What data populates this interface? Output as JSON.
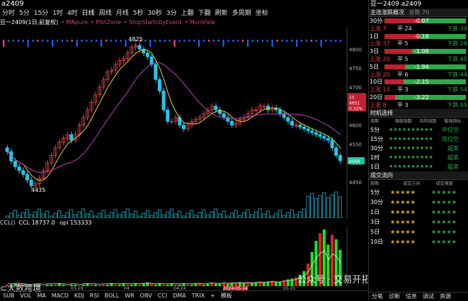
{
  "window": {
    "symbol": "a2409"
  },
  "toolbar": {
    "items": [
      "分时",
      "5分",
      "15分",
      "1时",
      "4时",
      "日线",
      "周线",
      "月线",
      "5秒",
      "30秒",
      "3分",
      "上翻",
      "下翻",
      "刷新",
      "多周期",
      "坐标"
    ]
  },
  "indicator_row": [
    "豆一2409(1日,前复权)",
    "MApure",
    "PlotZone",
    "StopStartsbyEvent",
    "MonView"
  ],
  "price_axis": [
    "4800",
    "4750",
    "4700",
    "4650",
    "4600",
    "4550",
    "4500",
    "4450"
  ],
  "price_box": {
    "line1": "15",
    "line2": "4651",
    "line3": "0.32%"
  },
  "last_price_tag": "4506",
  "high_label": "4825",
  "low_label": "4435",
  "volume_label": {
    "name": "CCL()",
    "ccl": "CCL 18737.0",
    "opi": "opi 153333"
  },
  "date_axis": [
    "03-19",
    "04",
    "04-24",
    "2024-05-14",
    "05-31"
  ],
  "bottom_tabs": [
    "SUB",
    "VOL",
    "MA",
    "MACD",
    "KDJ",
    "RSI",
    "BOLL",
    "WR",
    "OBV",
    "CCI",
    "DMA",
    "TRIX",
    "+",
    "模板"
  ],
  "right_panel": {
    "title": "豆一2409 a2409",
    "summary_section": "主连涨跌概况",
    "summary_sub": "总数 70",
    "rows": [
      {
        "period": "30分",
        "value": "-0.07",
        "up": "",
        "flat": "",
        "down": ""
      },
      {
        "period": "",
        "value": "",
        "up": "上涨 7",
        "flat": "平 24",
        "down": "下跌 39"
      },
      {
        "period": "1日",
        "value": "-0.18",
        "up": "",
        "flat": "",
        "down": ""
      },
      {
        "period": "",
        "value": "",
        "up": "上涨 37",
        "flat": "平 5",
        "down": "下跌 28"
      },
      {
        "period": "3日",
        "value": "-1.08",
        "up": "",
        "flat": "",
        "down": ""
      },
      {
        "period": "",
        "value": "",
        "up": "上涨 20",
        "flat": "平 5",
        "down": "下跌 45"
      },
      {
        "period": "5日",
        "value": "-1.94",
        "up": "",
        "flat": "",
        "down": ""
      },
      {
        "period": "",
        "value": "",
        "up": "上涨 20",
        "flat": "平 6",
        "down": "下跌 44"
      },
      {
        "period": "10日",
        "value": "-2.15",
        "up": "",
        "flat": "",
        "down": ""
      },
      {
        "period": "",
        "value": "",
        "up": "上涨 13",
        "flat": "平 3",
        "down": "下跌 54"
      },
      {
        "period": "20日",
        "value": "-3.22",
        "up": "",
        "flat": "",
        "down": ""
      },
      {
        "period": "",
        "value": "",
        "up": "上涨 8",
        "flat": "平 3",
        "down": "下跌 59"
      }
    ],
    "signal_section": "时机选择",
    "signal_headers": [
      "周期",
      "强度指数",
      "风险指数",
      "做强指标"
    ],
    "signals": [
      {
        "period": "5分",
        "stars": "★★★★★★★★★★",
        "text": "中位空"
      },
      {
        "period": "15分",
        "stars": "★★★★★★★★★★",
        "text": "低位空"
      },
      {
        "period": "30分",
        "stars": "★★★★★★★★★★",
        "text": "超卖"
      },
      {
        "period": "1时",
        "stars": "★★★★★★★★★★",
        "text": "超卖"
      },
      {
        "period": "1日",
        "stars": "★★★★★★★★★★",
        "text": "超卖"
      }
    ],
    "direction_section": "成交流向",
    "direction_headers": [
      "周期",
      "成交方向",
      "成交强度"
    ],
    "directions": [
      {
        "period": "5分",
        "s1": "★★★★★",
        "s2": "★★★★★"
      },
      {
        "period": "30分",
        "s1": "★★★★★",
        "s2": "★★★★★"
      },
      {
        "period": "1日",
        "s1": "★★★★★",
        "s2": "★★★★★"
      },
      {
        "period": "3日",
        "s1": "★★★★★",
        "s2": "★★★★★"
      },
      {
        "period": "5日",
        "s1": "★★★★★",
        "s2": "★★★★★"
      },
      {
        "period": "10日",
        "s1": "★★★★★",
        "s2": "★★★★★"
      }
    ],
    "bottom_tabs": [
      "分笔",
      "诊断",
      "信息",
      "调试",
      "资源"
    ]
  },
  "watermark": "公众号 · 交易开拓者TB",
  "logo_text": "大数跨境",
  "colors": {
    "up": "#e04040",
    "down": "#22c8e8",
    "ma_yellow": "#e8d040",
    "ma_purple": "#c040c0",
    "vol_green": "#22e022"
  },
  "chart_data": {
    "type": "candlestick",
    "price_ylim": [
      4420,
      4840
    ],
    "closes_approx": [
      4530,
      4505,
      4490,
      4480,
      4470,
      4455,
      4440,
      4445,
      4460,
      4480,
      4500,
      4520,
      4540,
      4555,
      4565,
      4575,
      4560,
      4575,
      4600,
      4620,
      4640,
      4660,
      4680,
      4700,
      4720,
      4740,
      4745,
      4760,
      4770,
      4775,
      4790,
      4805,
      4810,
      4800,
      4790,
      4780,
      4760,
      4720,
      4690,
      4640,
      4610,
      4610,
      4620,
      4600,
      4590,
      4600,
      4610,
      4615,
      4620,
      4630,
      4640,
      4650,
      4640,
      4630,
      4620,
      4610,
      4600,
      4605,
      4615,
      4620,
      4630,
      4640,
      4640,
      4650,
      4650,
      4640,
      4645,
      4640,
      4630,
      4620,
      4610,
      4600,
      4600,
      4595,
      4590,
      4585,
      4580,
      4575,
      4570,
      4565,
      4560,
      4540,
      4520,
      4506
    ],
    "volume_series": "CCL",
    "volume_values_approx": [
      2,
      2,
      3,
      3,
      2,
      1,
      1,
      2,
      2,
      1,
      2,
      2,
      2,
      3,
      2,
      1,
      2,
      2,
      1,
      2,
      3,
      2,
      2,
      1,
      2,
      2,
      3,
      2,
      2,
      3,
      2,
      2,
      3,
      2,
      3,
      4,
      3,
      2,
      3,
      2,
      2,
      3,
      2,
      2,
      3,
      2,
      2,
      3,
      3,
      2,
      3,
      4,
      3,
      3,
      4,
      3,
      4,
      4,
      5,
      4,
      5,
      4,
      5,
      6,
      5,
      6,
      7,
      6,
      6,
      8,
      9,
      10,
      12,
      15,
      20,
      30,
      45,
      60,
      70,
      75,
      55,
      68,
      62,
      48
    ]
  }
}
